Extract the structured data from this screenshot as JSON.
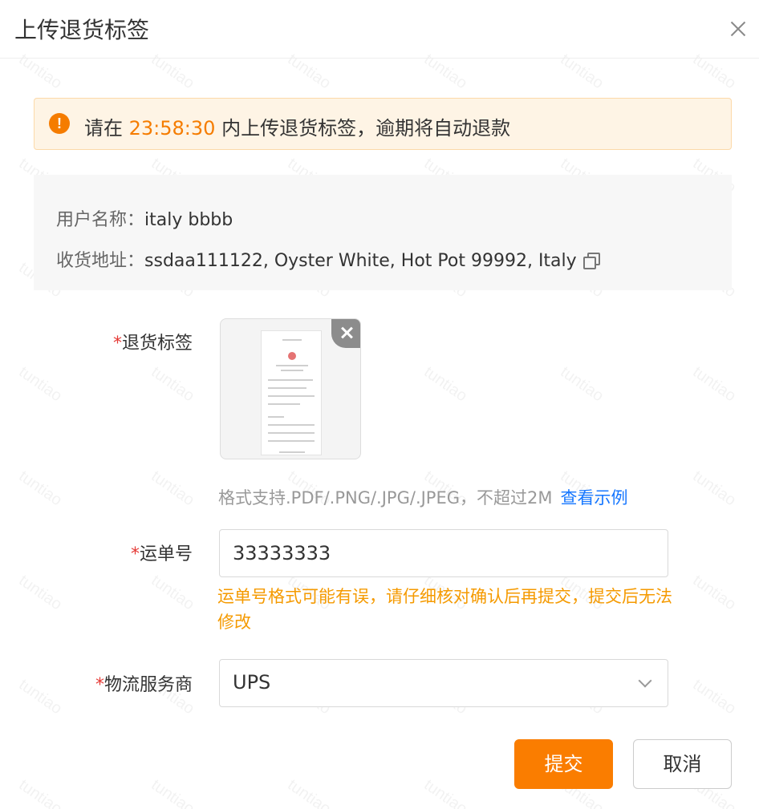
{
  "dialog": {
    "title": "上传退货标签"
  },
  "alert": {
    "prefix": "请在 ",
    "countdown": "23:58:30",
    "suffix": " 内上传退货标签，逾期将自动退款"
  },
  "info": {
    "username_label": "用户名称：",
    "username": "italy bbbb",
    "address_label": "收货地址：",
    "address": "ssdaa111122, Oyster White, Hot Pot 99992, Italy"
  },
  "form": {
    "required_mark": "*",
    "label_field_label": "退货标签",
    "file_hint": "格式支持.PDF/.PNG/.JPG/.JPEG，不超过2M",
    "view_example": "查看示例",
    "tracking_label": "运单号",
    "tracking_value": "33333333",
    "tracking_warning": "运单号格式可能有误，请仔细核对确认后再提交，提交后无法修改",
    "carrier_label": "物流服务商",
    "carrier_value": "UPS"
  },
  "actions": {
    "submit": "提交",
    "cancel": "取消"
  },
  "watermark": "tuntiao",
  "colors": {
    "accent": "#fa7d00",
    "link": "#1677ff",
    "warning": "#f59a00",
    "required": "#e53935"
  }
}
